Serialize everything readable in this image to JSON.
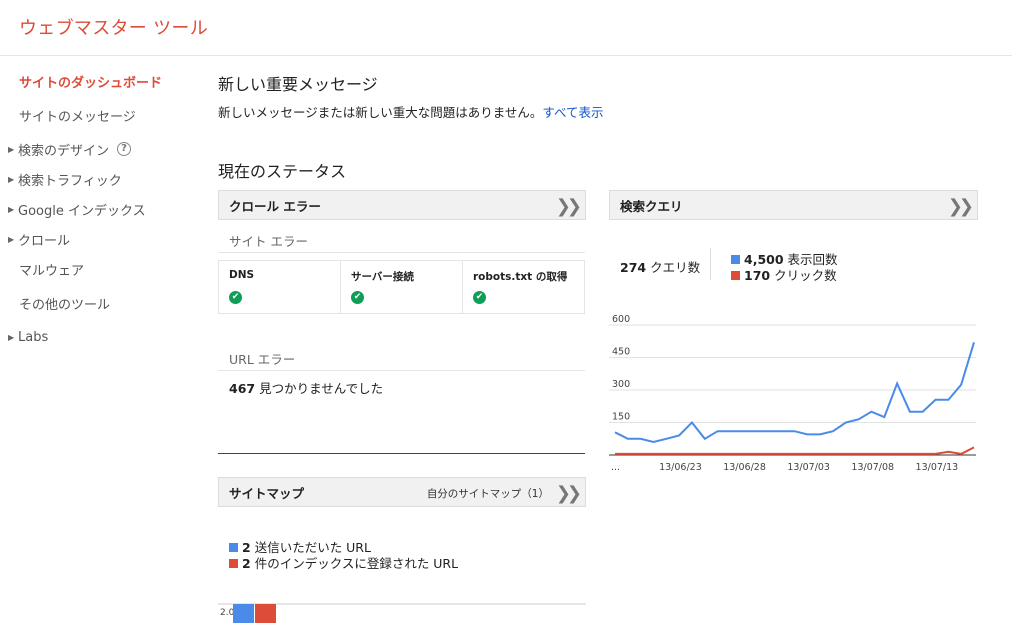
{
  "app": {
    "title": "ウェブマスター ツール"
  },
  "sidebar": {
    "items": [
      {
        "label": "サイトのダッシュボード",
        "active": true,
        "arrow": false
      },
      {
        "label": "サイトのメッセージ",
        "active": false,
        "arrow": false
      },
      {
        "label": "検索のデザイン",
        "active": false,
        "arrow": true,
        "help": "?"
      },
      {
        "label": "検索トラフィック",
        "active": false,
        "arrow": true
      },
      {
        "label": "Google インデックス",
        "active": false,
        "arrow": true
      },
      {
        "label": "クロール",
        "active": false,
        "arrow": true
      },
      {
        "label": "マルウェア",
        "active": false,
        "arrow": false
      },
      {
        "label": "その他のツール",
        "active": false,
        "arrow": false
      },
      {
        "label": "Labs",
        "active": false,
        "arrow": true
      }
    ]
  },
  "messages": {
    "heading": "新しい重要メッセージ",
    "text": "新しいメッセージまたは新しい重大な問題はありません。",
    "link": "すべて表示"
  },
  "status": {
    "heading": "現在のステータス"
  },
  "crawl": {
    "title": "クロール エラー",
    "site_errors_label": "サイト エラー",
    "columns": [
      "DNS",
      "サーバー接続",
      "robots.txt の取得"
    ],
    "url_errors_label": "URL エラー",
    "url_error_count": "467",
    "url_error_text": "見つかりませんでした"
  },
  "sitemap": {
    "title": "サイトマップ",
    "link": "自分のサイトマップ（1）",
    "submitted_count": "2",
    "submitted_label": "送信いただいた URL",
    "indexed_count": "2",
    "indexed_label": "件のインデックスに登録された URL",
    "axis_label": "2.0"
  },
  "search": {
    "title": "検索クエリ",
    "query_count": "274",
    "query_label": "クエリ数",
    "impressions_count": "4,500",
    "impressions_label": "表示回数",
    "clicks_count": "170",
    "clicks_label": "クリック数"
  },
  "colors": {
    "accent": "#dd4b39",
    "link": "#1155cc",
    "impressions": "#4a8ae8",
    "clicks": "#dd4b39",
    "ok": "#0f9d58"
  },
  "icons": [
    "chevron-double-right-icon",
    "check-circle-icon",
    "help-icon",
    "triangle-right-icon"
  ],
  "chart_data": [
    {
      "type": "line",
      "x": [
        "13/06/18",
        "13/06/19",
        "13/06/20",
        "13/06/21",
        "13/06/22",
        "13/06/23",
        "13/06/24",
        "13/06/25",
        "13/06/26",
        "13/06/27",
        "13/06/28",
        "13/06/29",
        "13/06/30",
        "13/07/01",
        "13/07/02",
        "13/07/03",
        "13/07/04",
        "13/07/05",
        "13/07/06",
        "13/07/07",
        "13/07/08",
        "13/07/09",
        "13/07/10",
        "13/07/11",
        "13/07/12",
        "13/07/13",
        "13/07/14",
        "13/07/15",
        "13/07/16"
      ],
      "xtick_labels": [
        "...",
        "13/06/23",
        "13/06/28",
        "13/07/03",
        "13/07/08",
        "13/07/13"
      ],
      "yticks": [
        "600",
        "450",
        "300",
        "150"
      ],
      "ylim": [
        0,
        600
      ],
      "series": [
        {
          "name": "表示回数",
          "color": "#4a8ae8",
          "values": [
            105,
            75,
            75,
            60,
            75,
            90,
            150,
            75,
            110,
            110,
            110,
            110,
            110,
            110,
            110,
            95,
            95,
            110,
            150,
            165,
            200,
            175,
            330,
            200,
            200,
            255,
            255,
            325,
            520
          ]
        },
        {
          "name": "クリック数",
          "color": "#dd4b39",
          "values": [
            5,
            5,
            5,
            5,
            5,
            5,
            5,
            5,
            5,
            5,
            5,
            5,
            5,
            5,
            5,
            5,
            5,
            5,
            5,
            5,
            5,
            5,
            5,
            5,
            5,
            5,
            15,
            5,
            35
          ]
        }
      ],
      "grid": true
    },
    {
      "type": "bar",
      "categories": [
        "送信いただいた URL",
        "件のインデックスに登録された URL"
      ],
      "values": [
        2,
        2
      ],
      "colors": [
        "#4a8ae8",
        "#dd4b39"
      ],
      "yticks": [
        "2.0"
      ]
    }
  ]
}
